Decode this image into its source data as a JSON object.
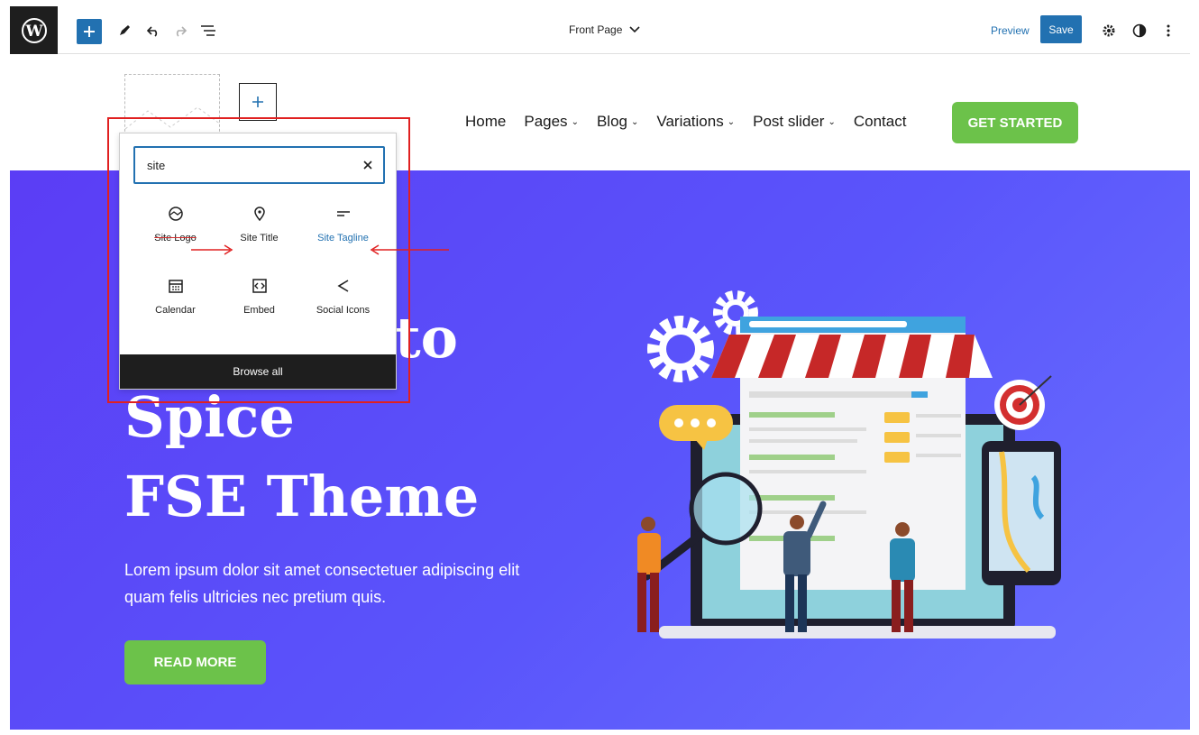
{
  "toolbar": {
    "document_title": "Front Page",
    "preview_label": "Preview",
    "save_label": "Save"
  },
  "site_header": {
    "nav": [
      {
        "label": "Home",
        "has_dropdown": false
      },
      {
        "label": "Pages",
        "has_dropdown": true
      },
      {
        "label": "Blog",
        "has_dropdown": true
      },
      {
        "label": "Variations",
        "has_dropdown": true
      },
      {
        "label": "Post slider",
        "has_dropdown": true
      },
      {
        "label": "Contact",
        "has_dropdown": false
      }
    ],
    "cta_label": "GET STARTED"
  },
  "inserter": {
    "search_value": "site",
    "blocks": [
      {
        "label": "Site Logo",
        "icon": "site-logo-icon"
      },
      {
        "label": "Site Title",
        "icon": "map-pin-icon"
      },
      {
        "label": "Site Tagline",
        "icon": "tagline-icon"
      },
      {
        "label": "Calendar",
        "icon": "calendar-icon"
      },
      {
        "label": "Embed",
        "icon": "embed-icon"
      },
      {
        "label": "Social Icons",
        "icon": "share-icon"
      }
    ],
    "browse_all_label": "Browse all"
  },
  "hero": {
    "heading_line_1": "to",
    "heading_line_2": "Spice",
    "heading_line_3": "FSE Theme",
    "body_text": "Lorem ipsum dolor sit amet consectetuer adipiscing elit quam felis ultricies nec pretium quis.",
    "button_label": "READ MORE"
  },
  "colors": {
    "wp_dark": "#1e1e1e",
    "admin_blue": "#2271b1",
    "cta_green": "#6cc24a",
    "hero_purple": "#5a4af7",
    "annotation_red": "#e02020"
  }
}
